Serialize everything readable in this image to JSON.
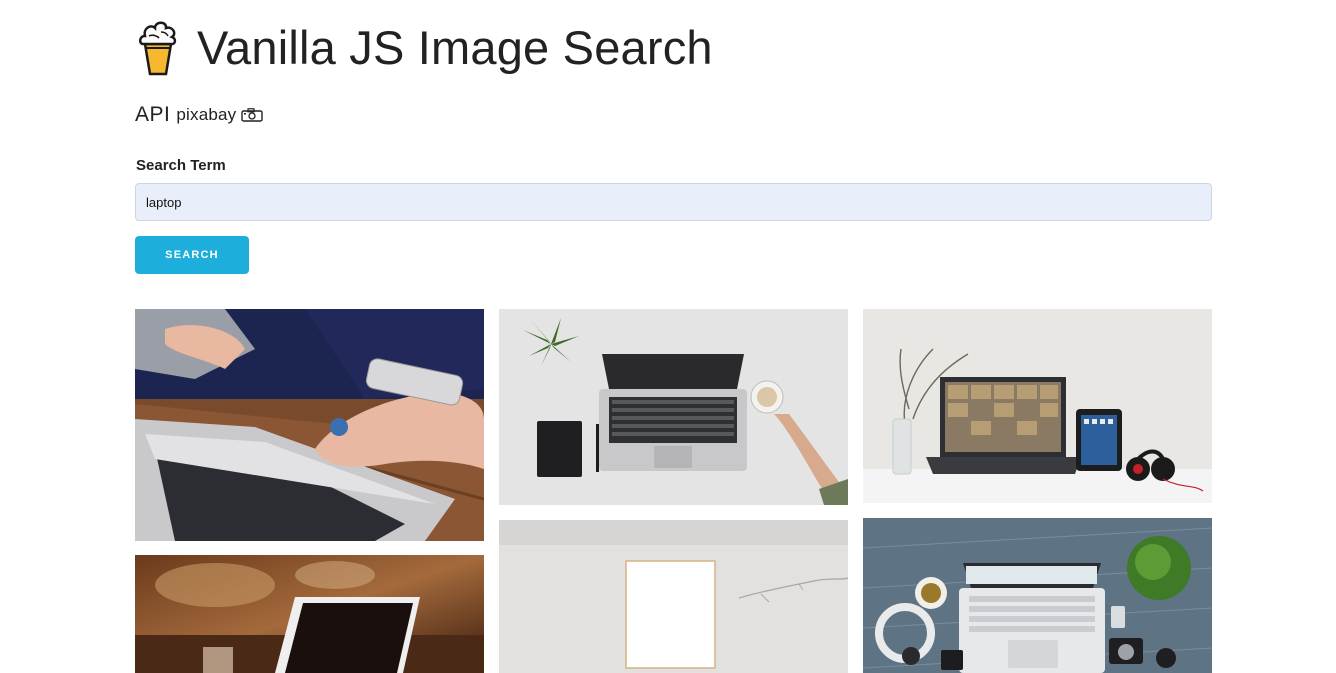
{
  "app": {
    "title": "Vanilla JS Image Search",
    "logo_icon": "ice-cream-icon"
  },
  "api": {
    "prefix": "API",
    "provider": "pixabay",
    "provider_icon": "camera-icon"
  },
  "search": {
    "label": "Search Term",
    "value": "laptop",
    "button_label": "SEARCH"
  },
  "colors": {
    "accent": "#1eaedb",
    "input_bg": "#e8effb"
  },
  "results": [
    "hands-with-phone-and-laptop-photo",
    "laptop-notebook-plant-coffee-photo",
    "laptop-tablet-headphones-desk-photo",
    "laptop-on-cafe-table-photo",
    "blank-paper-frame-on-wall-photo",
    "laptop-headphones-plant-overhead-photo"
  ]
}
